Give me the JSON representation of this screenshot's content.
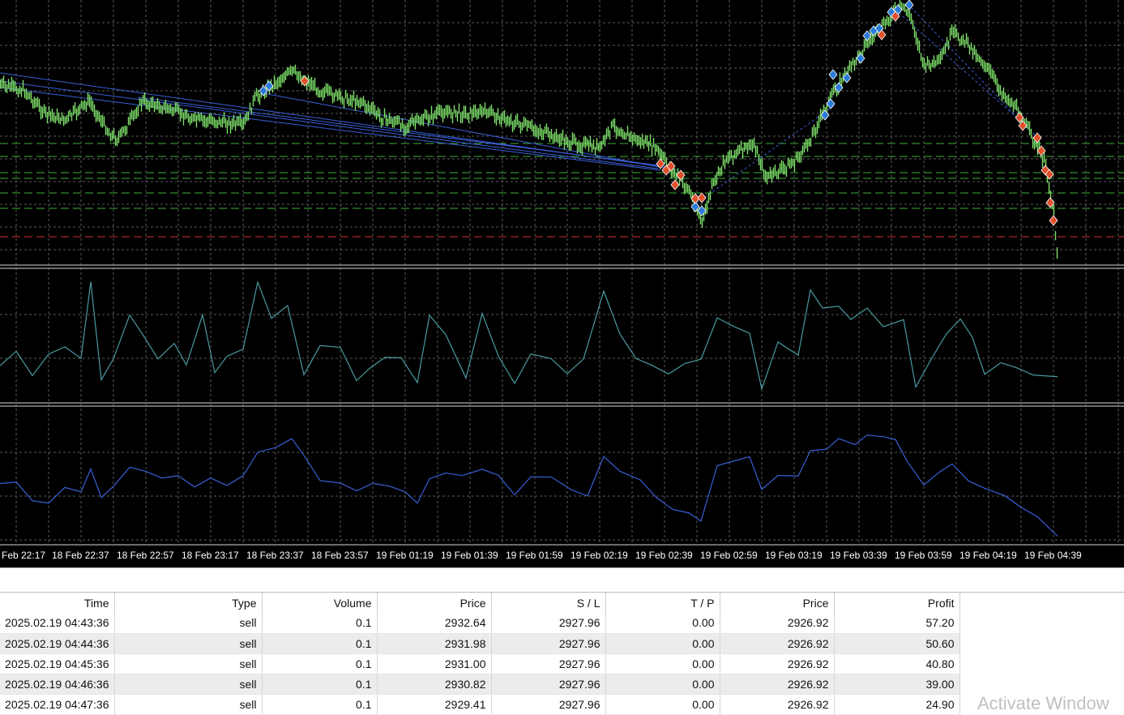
{
  "chart": {
    "colors": {
      "background": "#000000",
      "grid": "#5a5a5a",
      "candles": "#7ee06a",
      "osc1": "#4a9aa0",
      "osc2": "#3a5fd6",
      "buy_marker": "#2a7ad8",
      "sell_marker": "#e0502a",
      "level_green": "#3fae3a",
      "level_red": "#d63030"
    },
    "time_labels": [
      "Feb 22:17",
      "18 Feb 22:37",
      "18 Feb 22:57",
      "18 Feb 23:17",
      "18 Feb 23:37",
      "18 Feb 23:57",
      "19 Feb 01:19",
      "19 Feb 01:39",
      "19 Feb 01:59",
      "19 Feb 02:19",
      "19 Feb 02:39",
      "19 Feb 02:59",
      "19 Feb 03:19",
      "19 Feb 03:39",
      "19 Feb 03:59",
      "19 Feb 04:19",
      "19 Feb 04:39"
    ]
  },
  "trades": {
    "columns": [
      "Time",
      "Type",
      "Volume",
      "Price",
      "S / L",
      "T / P",
      "Price",
      "Profit"
    ],
    "rows": [
      {
        "time": "2025.02.19 04:43:36",
        "type": "sell",
        "volume": "0.1",
        "price": "2932.64",
        "sl": "2927.96",
        "tp": "0.00",
        "close_price": "2926.92",
        "profit": "57.20"
      },
      {
        "time": "2025.02.19 04:44:36",
        "type": "sell",
        "volume": "0.1",
        "price": "2931.98",
        "sl": "2927.96",
        "tp": "0.00",
        "close_price": "2926.92",
        "profit": "50.60"
      },
      {
        "time": "2025.02.19 04:45:36",
        "type": "sell",
        "volume": "0.1",
        "price": "2931.00",
        "sl": "2927.96",
        "tp": "0.00",
        "close_price": "2926.92",
        "profit": "40.80"
      },
      {
        "time": "2025.02.19 04:46:36",
        "type": "sell",
        "volume": "0.1",
        "price": "2930.82",
        "sl": "2927.96",
        "tp": "0.00",
        "close_price": "2926.92",
        "profit": "39.00"
      },
      {
        "time": "2025.02.19 04:47:36",
        "type": "sell",
        "volume": "0.1",
        "price": "2929.41",
        "sl": "2927.96",
        "tp": "0.00",
        "close_price": "2926.92",
        "profit": "24.90"
      }
    ]
  },
  "watermark": "Activate Window"
}
